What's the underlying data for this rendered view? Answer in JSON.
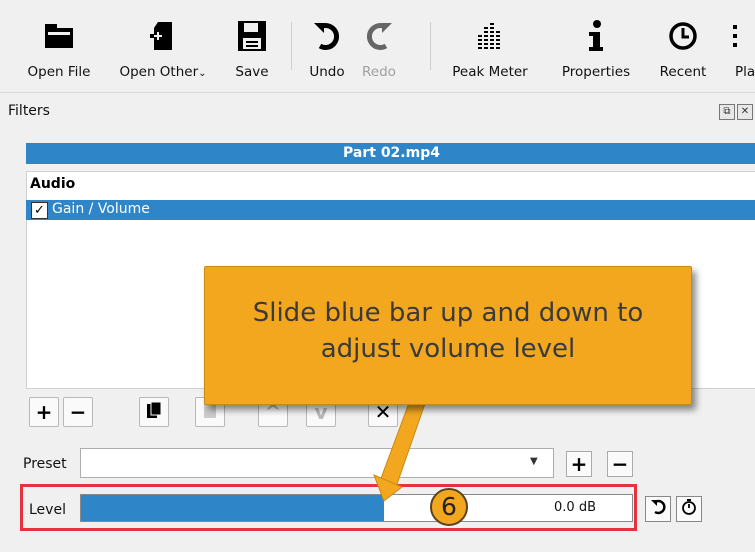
{
  "toolbar": {
    "items": [
      {
        "label": "Open File",
        "icon": "folder-icon",
        "enabled": true
      },
      {
        "label": "Open Other",
        "icon": "file-plus-icon",
        "enabled": true
      },
      {
        "label": "Save",
        "icon": "floppy-icon",
        "enabled": true
      },
      {
        "label": "Undo",
        "icon": "undo-icon",
        "enabled": true
      },
      {
        "label": "Redo",
        "icon": "redo-icon",
        "enabled": false
      },
      {
        "label": "Peak Meter",
        "icon": "peak-meter-icon",
        "enabled": true
      },
      {
        "label": "Properties",
        "icon": "info-icon",
        "enabled": true
      },
      {
        "label": "Recent",
        "icon": "clock-icon",
        "enabled": true
      },
      {
        "label": "Pla",
        "icon": "more-icon",
        "enabled": true
      }
    ]
  },
  "filters": {
    "title": "Filters",
    "clip_name": "Part 02.mp4",
    "group_heading": "Audio",
    "items": [
      {
        "label": "Gain / Volume",
        "checked": true,
        "check_glyph": "✓",
        "selected": true
      }
    ]
  },
  "actions": {
    "add": "+",
    "remove": "−",
    "copy_icon": "copy-icon",
    "paste_icon": "paste-icon",
    "move_up": "^",
    "move_down": "v",
    "deselect": "✕"
  },
  "preset": {
    "label": "Preset",
    "value": "",
    "add": "+",
    "remove": "−"
  },
  "level": {
    "label": "Level",
    "value_text": "0.0 dB",
    "fill_fraction": 0.55,
    "reset_glyph": "↶",
    "keyframe_glyph": "⏱"
  },
  "callout": {
    "line1": "Slide blue bar up and down to",
    "line2": "adjust volume level",
    "step_number": "6"
  },
  "colors": {
    "accent": "#2e86c9",
    "callout": "#f3a71f",
    "highlight": "#e5323f"
  }
}
